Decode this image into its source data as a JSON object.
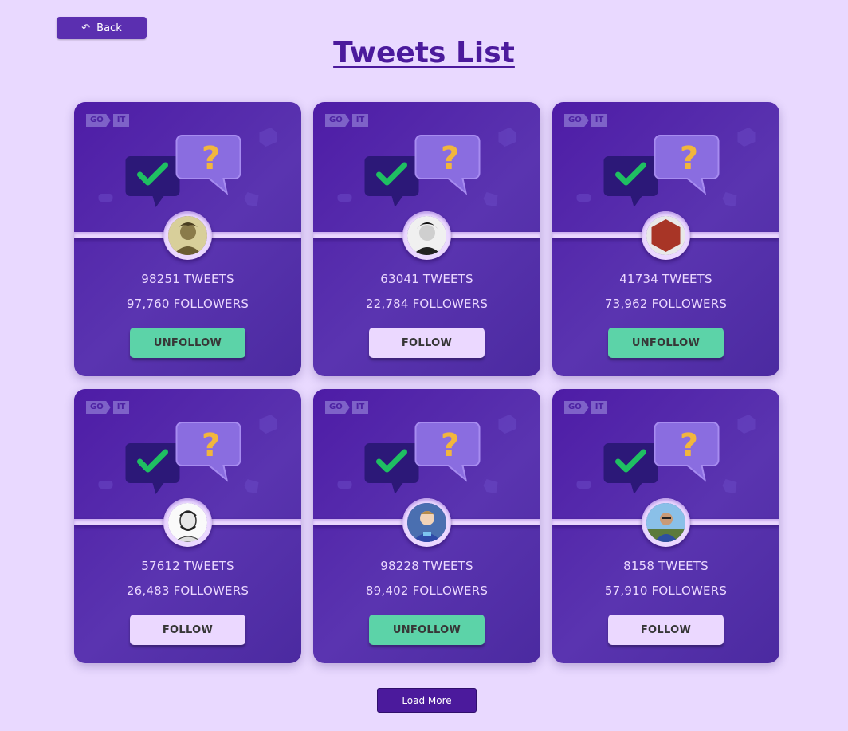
{
  "header": {
    "back_label": "Back",
    "back_icon": "undo-arrow-icon",
    "title": "Tweets List"
  },
  "logo": {
    "part1": "GO",
    "part2": "IT"
  },
  "cards": [
    {
      "tweets": "98251 TWEETS",
      "followers": "97,760 FOLLOWERS",
      "button": "UNFOLLOW",
      "state": "unfollow",
      "avatar": "sepia-portrait"
    },
    {
      "tweets": "63041 TWEETS",
      "followers": "22,784 FOLLOWERS",
      "button": "FOLLOW",
      "state": "follow",
      "avatar": "bw-portrait"
    },
    {
      "tweets": "41734 TWEETS",
      "followers": "73,962 FOLLOWERS",
      "button": "UNFOLLOW",
      "state": "unfollow",
      "avatar": "red-hexagon"
    },
    {
      "tweets": "57612 TWEETS",
      "followers": "26,483 FOLLOWERS",
      "button": "FOLLOW",
      "state": "follow",
      "avatar": "sketch-portrait"
    },
    {
      "tweets": "98228 TWEETS",
      "followers": "89,402 FOLLOWERS",
      "button": "UNFOLLOW",
      "state": "unfollow",
      "avatar": "blue-shirt-portrait"
    },
    {
      "tweets": "8158 TWEETS",
      "followers": "57,910 FOLLOWERS",
      "button": "FOLLOW",
      "state": "follow",
      "avatar": "outdoor-portrait"
    }
  ],
  "footer": {
    "load_more_label": "Load More"
  },
  "colors": {
    "background": "#e9d9ff",
    "accent": "#4b1a9c",
    "follow_button": "#ebd8ff",
    "unfollow_button": "#5cd3a8"
  }
}
